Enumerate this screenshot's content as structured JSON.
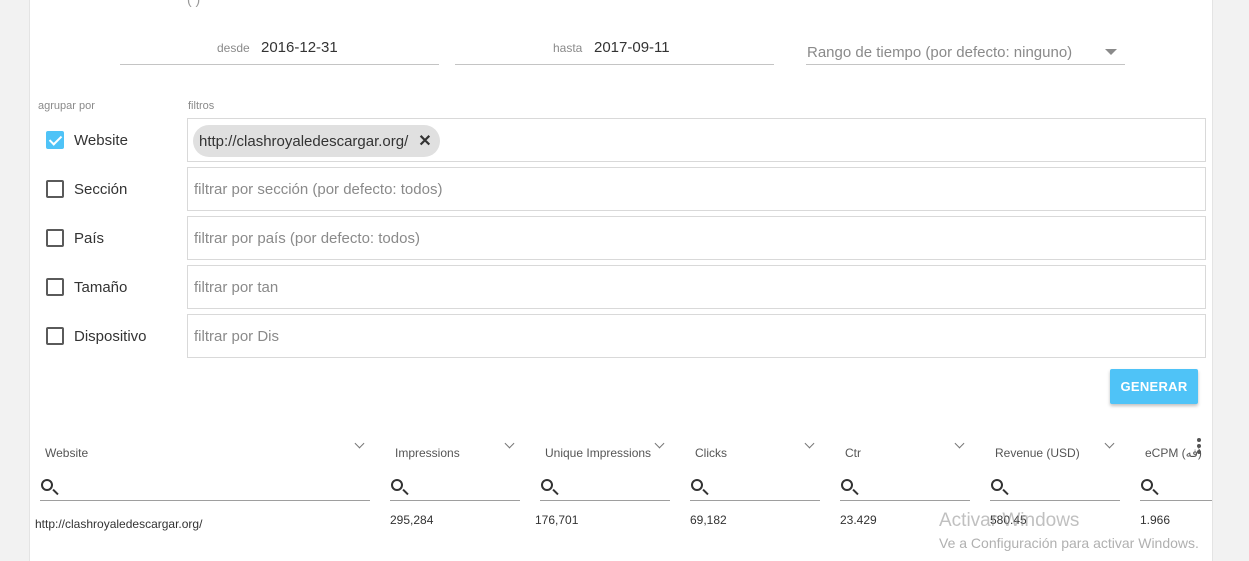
{
  "header_cut_text": "(                                 )",
  "dates": {
    "from_label": "desde",
    "from_value": "2016-12-31",
    "to_label": "hasta",
    "to_value": "2017-09-11",
    "range_placeholder": "Rango de tiempo (por defecto: ninguno)"
  },
  "labels": {
    "group_by": "agrupar por",
    "filters": "filtros"
  },
  "groups": [
    {
      "label": "Website",
      "checked": true
    },
    {
      "label": "Sección",
      "checked": false
    },
    {
      "label": "País",
      "checked": false
    },
    {
      "label": "Tamaño",
      "checked": false
    },
    {
      "label": "Dispositivo",
      "checked": false
    }
  ],
  "filters": {
    "website_chip": "http://clashroyaledescargar.org/",
    "section_placeholder": "filtrar por sección (por defecto: todos)",
    "country_placeholder": "filtrar por país (por defecto: todos)",
    "size_placeholder": "filtrar por tan",
    "device_placeholder": "filtrar por Dis"
  },
  "generate_label": "GENERAR",
  "table": {
    "columns": [
      "Website",
      "Impressions",
      "Unique Impressions",
      "Clicks",
      "Ctr",
      "Revenue (USD)",
      "eCPM (فه)"
    ],
    "rows": [
      [
        "http://clashroyaledescargar.org/",
        "295,284",
        "176,701",
        "69,182",
        "23.429",
        "580.45",
        "1.966"
      ]
    ]
  },
  "watermark": {
    "line1": "Activar Windows",
    "line2": "Ve a Configuración para activar Windows."
  },
  "colors": {
    "accent": "#4fc3f7"
  },
  "icons": [
    "check-icon",
    "close-icon",
    "dropdown-caret-icon",
    "search-icon",
    "kebab-menu-icon"
  ]
}
